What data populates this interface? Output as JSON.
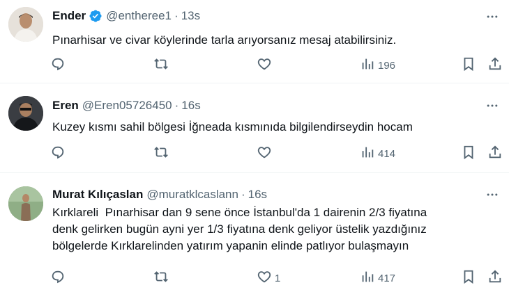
{
  "tweets": [
    {
      "name": "Ender",
      "handle": "@entheree1",
      "dot": "·",
      "time": "13s",
      "verified": true,
      "text": "Pınarhisar ve civar köylerinde tarla arıyorsanız mesaj atabilirsiniz.",
      "likes": "",
      "views": "196"
    },
    {
      "name": "Eren",
      "handle": "@Eren05726450",
      "dot": "·",
      "time": "16s",
      "verified": false,
      "text": "Kuzey kısmı sahil bölgesi İğneada kısmınıda bilgilendirseydin hocam",
      "likes": "",
      "views": "414"
    },
    {
      "name": "Murat Kılıçaslan",
      "handle": "@muratklcaslann",
      "dot": "·",
      "time": "16s",
      "verified": false,
      "text": "Kırklareli  Pınarhisar dan 9 sene önce İstanbul'da 1 dairenin 2/3 fiyatına\ndenk gelirken bugün ayni yer 1/3 fiyatına denk geliyor üstelik yazdığınız\nbölgelerde Kırklarelinden yatırım yapanin elinde patlıyor bulaşmayın",
      "likes": "1",
      "views": "417"
    }
  ],
  "icons": {
    "reply": "reply-icon",
    "retweet": "retweet-icon",
    "like": "like-icon",
    "views": "views-icon",
    "bookmark": "bookmark-icon",
    "share": "share-icon",
    "more": "more-icon",
    "verified": "verified-badge-icon"
  },
  "colors": {
    "text": "#0f1419",
    "muted": "#536471",
    "verified": "#1d9bf0",
    "divider": "#eff3f4"
  }
}
